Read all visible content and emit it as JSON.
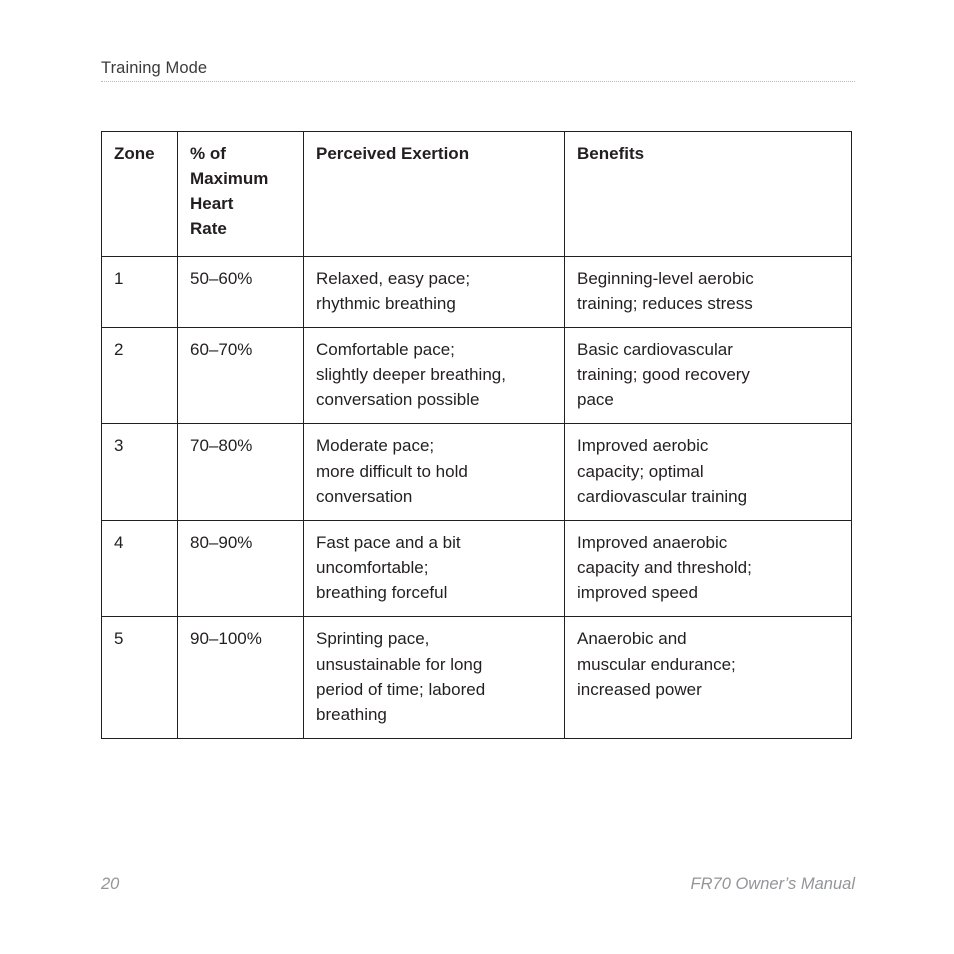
{
  "header": {
    "title": "Training Mode"
  },
  "table": {
    "columns": [
      {
        "key": "zone",
        "header_lines": [
          "Zone"
        ]
      },
      {
        "key": "pct",
        "header_lines": [
          "% of",
          "Maximum",
          "Heart",
          "Rate"
        ]
      },
      {
        "key": "exert",
        "header_lines": [
          "Perceived Exertion"
        ]
      },
      {
        "key": "benefit",
        "header_lines": [
          "Benefits"
        ]
      }
    ],
    "rows": [
      {
        "zone": [
          "1"
        ],
        "pct": [
          "50–60%"
        ],
        "exert": [
          "Relaxed, easy pace;",
          "rhythmic breathing"
        ],
        "benefit": [
          "Beginning-level aerobic",
          "training; reduces stress"
        ]
      },
      {
        "zone": [
          "2"
        ],
        "pct": [
          "60–70%"
        ],
        "exert": [
          "Comfortable pace;",
          "slightly deeper breathing,",
          "conversation possible"
        ],
        "benefit": [
          "Basic cardiovascular",
          "training; good recovery",
          "pace"
        ]
      },
      {
        "zone": [
          "3"
        ],
        "pct": [
          "70–80%"
        ],
        "exert": [
          "Moderate pace;",
          "more difficult to hold",
          "conversation"
        ],
        "benefit": [
          "Improved aerobic",
          "capacity; optimal",
          "cardiovascular training"
        ]
      },
      {
        "zone": [
          "4"
        ],
        "pct": [
          "80–90%"
        ],
        "exert": [
          "Fast pace and a bit",
          "uncomfortable;",
          "breathing forceful"
        ],
        "benefit": [
          "Improved anaerobic",
          "capacity and threshold;",
          "improved speed"
        ]
      },
      {
        "zone": [
          "5"
        ],
        "pct": [
          "90–100%"
        ],
        "exert": [
          "Sprinting pace,",
          "unsustainable for long",
          "period of time; labored",
          "breathing"
        ],
        "benefit": [
          "Anaerobic and",
          "muscular endurance;",
          "increased power"
        ]
      }
    ]
  },
  "footer": {
    "page_number": "20",
    "manual_title": "FR70 Owner’s Manual"
  },
  "colors": {
    "text": "#231f20",
    "header_text": "#3b3b3b",
    "footer_text": "#939598",
    "rule": "#b9b9b9",
    "table_border": "#231f20",
    "background": "#ffffff"
  }
}
